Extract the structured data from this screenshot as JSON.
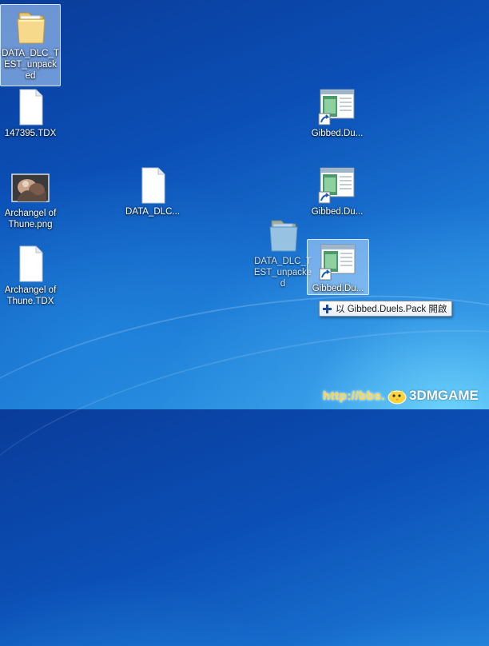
{
  "desktop": {
    "icons": [
      {
        "label": "DATA_DLC_TEST_unpacked",
        "type": "folder"
      },
      {
        "label": "147395.TDX",
        "type": "file"
      },
      {
        "label": "Archangel of Thune.png",
        "type": "image"
      },
      {
        "label": "Archangel of Thune.TDX",
        "type": "file"
      },
      {
        "label": "DATA_DLC...",
        "type": "file"
      },
      {
        "label": "DATA_DLC_TEST_unpacked",
        "type": "folder-dragging"
      },
      {
        "label": "Gibbed.Du...",
        "type": "shortcut"
      },
      {
        "label": "Gibbed.Du...",
        "type": "shortcut"
      },
      {
        "label": "Gibbed.Du...",
        "type": "shortcut-drop-target"
      }
    ]
  },
  "drag_tooltip": {
    "text": "以 Gibbed.Duels.Pack 開啟"
  },
  "watermark": {
    "url": "http://bbs.",
    "brand": "3DMGAME"
  },
  "colors": {
    "selection": "#bedcff",
    "tooltip_border": "#7a8ca8",
    "watermark_url": "#ffd43b"
  }
}
